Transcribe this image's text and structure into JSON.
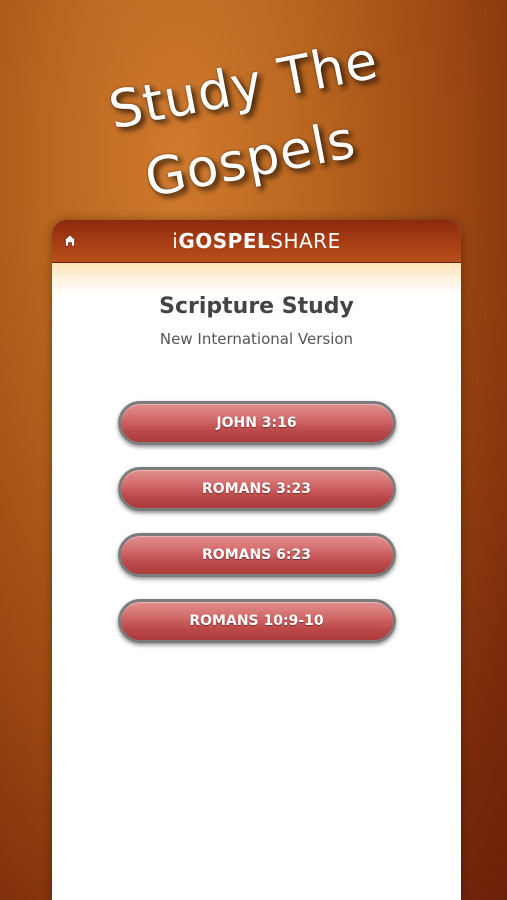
{
  "promo": {
    "line1": "Study The",
    "line2": "Gospels"
  },
  "header": {
    "brand_prefix": "i",
    "brand_bold": "GOSPEL",
    "brand_suffix": "SHARE",
    "home_icon": "home-icon"
  },
  "page": {
    "title": "Scripture Study",
    "subtitle": "New International Version"
  },
  "verses": [
    {
      "label": "JOHN 3:16"
    },
    {
      "label": "ROMANS 3:23"
    },
    {
      "label": "ROMANS 6:23"
    },
    {
      "label": "ROMANS 10:9-10"
    }
  ],
  "colors": {
    "background": "#9c4712",
    "header": "#a33a14",
    "button": "#c45858",
    "button_border": "#7c7c7c",
    "title_text": "#444444"
  }
}
